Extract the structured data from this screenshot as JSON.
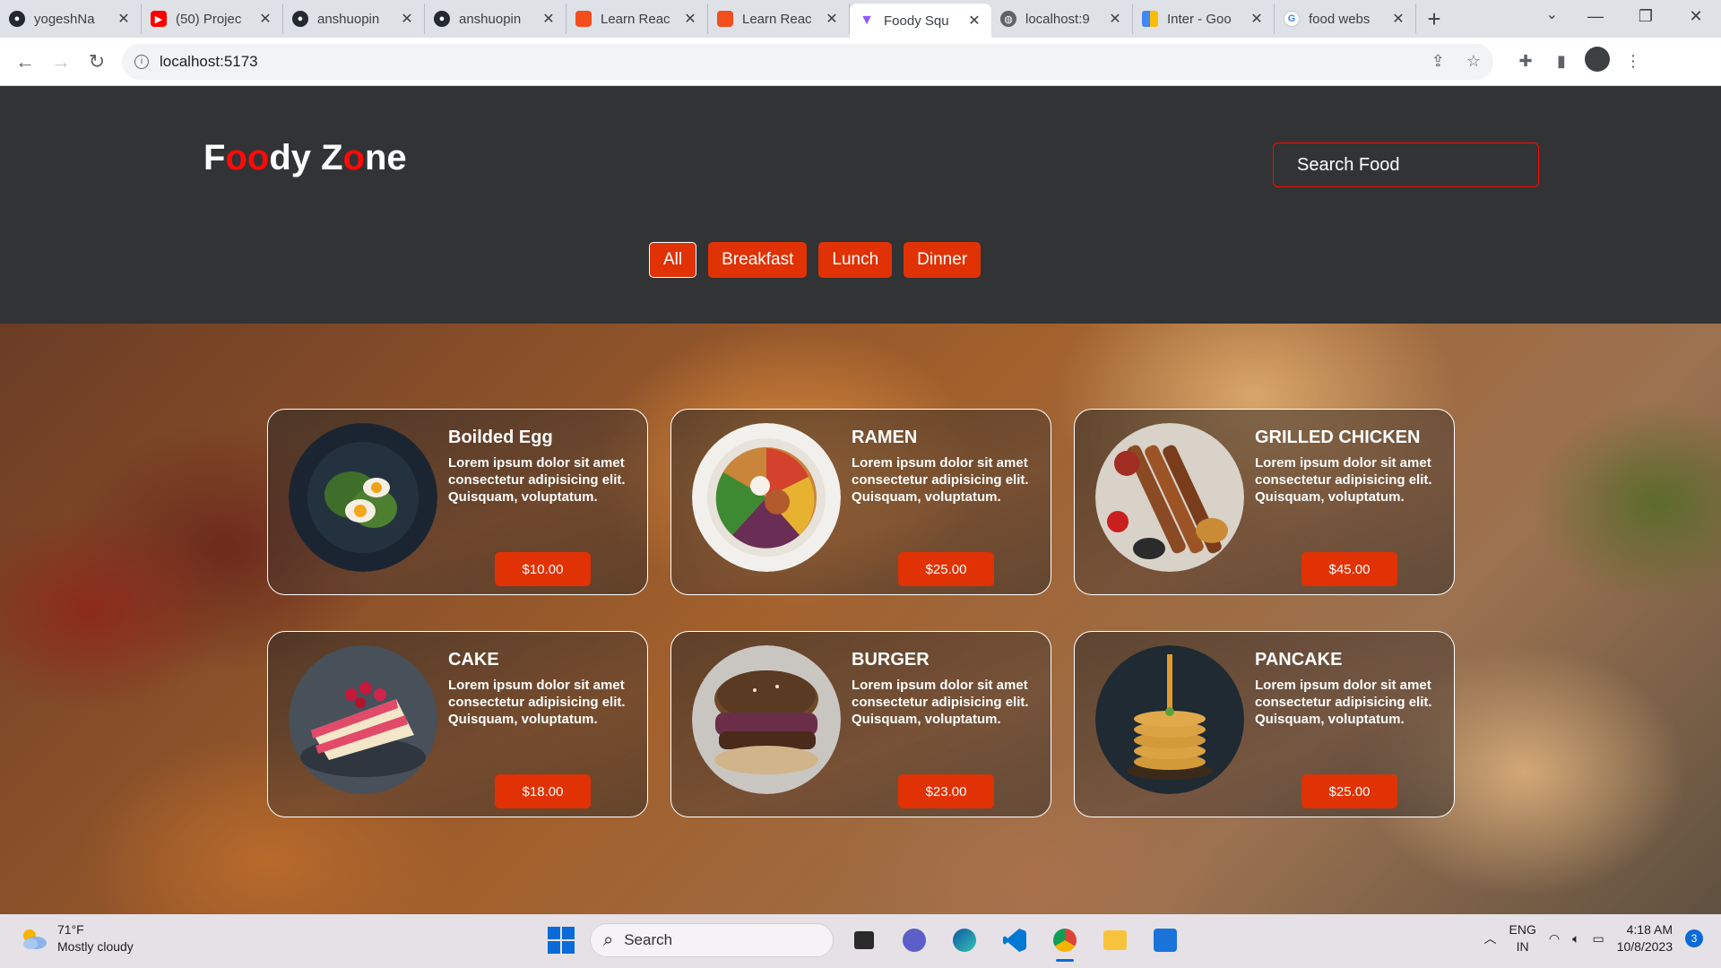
{
  "browser": {
    "tabs": [
      {
        "title": "yogeshNa",
        "icon": "github-icon",
        "color": "#24292f"
      },
      {
        "title": "(50) Projec",
        "icon": "youtube-icon",
        "color": "#ff0000"
      },
      {
        "title": "anshuopin",
        "icon": "github-icon",
        "color": "#24292f"
      },
      {
        "title": "anshuopin",
        "icon": "github-icon",
        "color": "#24292f"
      },
      {
        "title": "Learn Reac",
        "icon": "figma-icon",
        "color": "#f24e1e"
      },
      {
        "title": "Learn Reac",
        "icon": "figma-icon",
        "color": "#f24e1e"
      },
      {
        "title": "Foody Squ",
        "icon": "vite-icon",
        "color": "#8e5cf7"
      },
      {
        "title": "localhost:9",
        "icon": "globe-icon",
        "color": "#5f6368"
      },
      {
        "title": "Inter - Goo",
        "icon": "google-fonts-icon",
        "color": "#4285f4"
      },
      {
        "title": "food webs",
        "icon": "google-icon",
        "color": "#4285f4"
      }
    ],
    "url": "localhost:5173"
  },
  "header": {
    "logo": {
      "f": "F",
      "oo": "oo",
      "dy": "dy Z",
      "o": "o",
      "ne": "ne"
    },
    "search_placeholder": "Search Food",
    "filters": [
      "All",
      "Breakfast",
      "Lunch",
      "Dinner"
    ],
    "active_filter": "All",
    "accent_color": "#e03204",
    "logo_accent": "#ff0909"
  },
  "foods": [
    {
      "name": "Boilded Egg",
      "text": "Lorem ipsum dolor sit amet consectetur adipisicing elit. Quisquam, voluptatum.",
      "price": "$10.00",
      "image": "boiled-egg-plate"
    },
    {
      "name": "RAMEN",
      "text": "Lorem ipsum dolor sit amet consectetur adipisicing elit. Quisquam, voluptatum.",
      "price": "$25.00",
      "image": "ramen-bowl"
    },
    {
      "name": "GRILLED CHICKEN",
      "text": "Lorem ipsum dolor sit amet consectetur adipisicing elit. Quisquam, voluptatum.",
      "price": "$45.00",
      "image": "grilled-chicken-platter"
    },
    {
      "name": "CAKE",
      "text": "Lorem ipsum dolor sit amet consectetur adipisicing elit. Quisquam, voluptatum.",
      "price": "$18.00",
      "image": "raspberry-cake"
    },
    {
      "name": "BURGER",
      "text": "Lorem ipsum dolor sit amet consectetur adipisicing elit. Quisquam, voluptatum.",
      "price": "$23.00",
      "image": "burger"
    },
    {
      "name": "PANCAKE",
      "text": "Lorem ipsum dolor sit amet consectetur adipisicing elit. Quisquam, voluptatum.",
      "price": "$25.00",
      "image": "pancake-stack"
    }
  ],
  "taskbar": {
    "weather_temp": "71°F",
    "weather_desc": "Mostly cloudy",
    "search_label": "Search",
    "lang_top": "ENG",
    "lang_bottom": "IN",
    "time": "4:18 AM",
    "date": "10/8/2023",
    "notifications": "3"
  }
}
